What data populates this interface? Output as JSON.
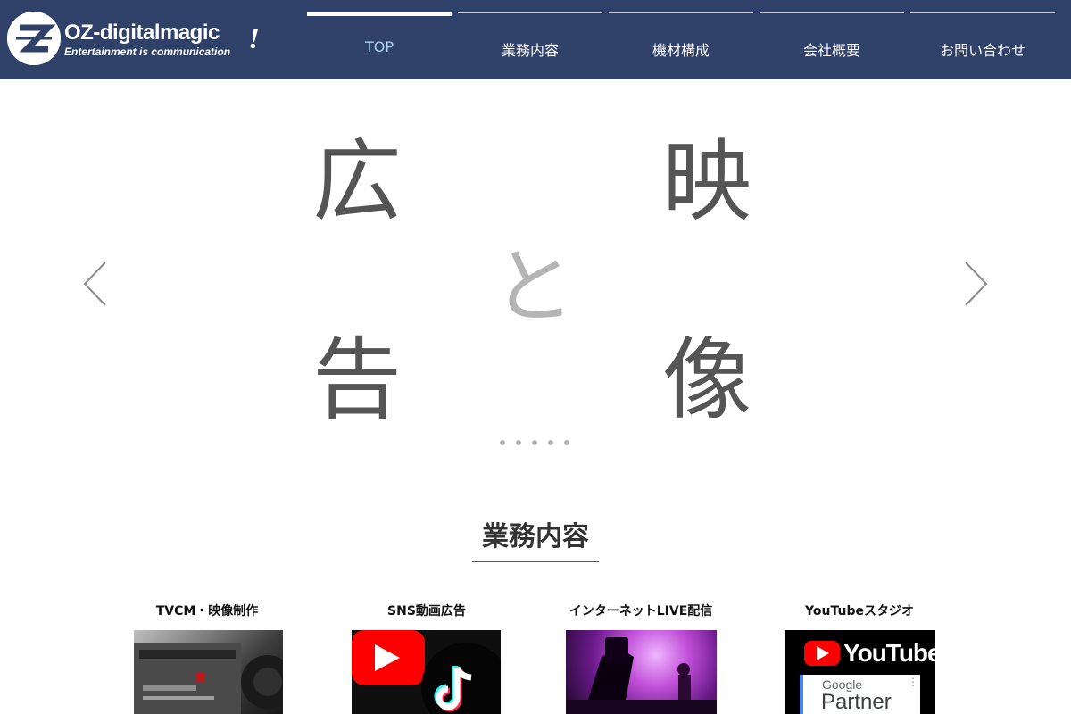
{
  "brand": {
    "name": "OZ-digitalmagic",
    "tagline": "Entertainment is communication",
    "exclaim": "!"
  },
  "nav": {
    "items": [
      {
        "label": "TOP"
      },
      {
        "label": "業務内容"
      },
      {
        "label": "機材構成"
      },
      {
        "label": "会社概要"
      },
      {
        "label": "お問い合わせ"
      }
    ]
  },
  "hero": {
    "chars": [
      "広",
      "映",
      "と",
      "告",
      "像"
    ],
    "slide_count": 5
  },
  "services": {
    "title": "業務内容",
    "items": [
      {
        "title": "TVCM・映像制作"
      },
      {
        "title": "SNS動画広告"
      },
      {
        "title": "インターネットLIVE配信"
      },
      {
        "title": "YouTubeスタジオ"
      }
    ],
    "youtube_wordmark": "YouTube",
    "google_label": "Google",
    "partner_label": "Partner"
  },
  "colors": {
    "header_bg": "#2f4069",
    "nav_active": "#a9d2f2",
    "youtube_red": "#ff0000"
  }
}
